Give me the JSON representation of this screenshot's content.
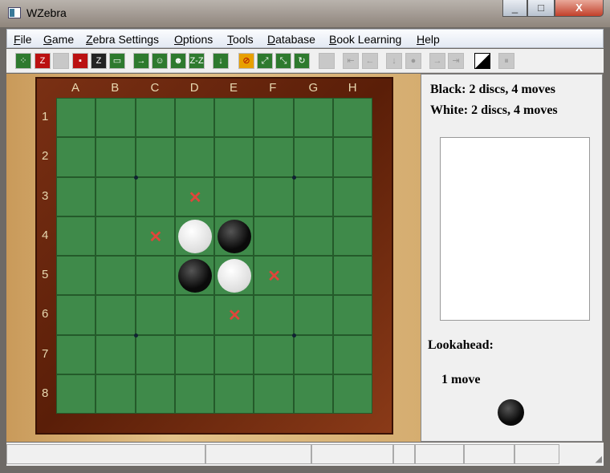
{
  "window": {
    "title": "WZebra",
    "min": "_",
    "max": "□",
    "close": "X"
  },
  "menu": [
    "File",
    "Game",
    "Zebra Settings",
    "Options",
    "Tools",
    "Database",
    "Book Learning",
    "Help"
  ],
  "toolbar": [
    {
      "icon": "new-game-icon",
      "c": "g",
      "t": "⁘"
    },
    {
      "icon": "zebra-book-icon",
      "c": "r",
      "t": "Z"
    },
    {
      "icon": "disabled-icon",
      "c": "d",
      "t": ""
    },
    {
      "icon": "save-book-icon",
      "c": "r",
      "t": "▪"
    },
    {
      "icon": "save-disk-icon",
      "c": "k",
      "t": "Z"
    },
    {
      "icon": "open-folder-icon",
      "c": "g",
      "t": "▭"
    },
    {
      "icon": "play-arrow-icon",
      "c": "g",
      "t": "→"
    },
    {
      "icon": "human-player-icon",
      "c": "g",
      "t": "☺"
    },
    {
      "icon": "computer-player-icon",
      "c": "g",
      "t": "☻"
    },
    {
      "icon": "auto-play-icon",
      "c": "g",
      "t": "Z-Z"
    },
    {
      "icon": "move-down-icon",
      "c": "g",
      "t": "↓"
    },
    {
      "icon": "stop-icon",
      "c": "o",
      "t": "⊘"
    },
    {
      "icon": "expand-icon",
      "c": "g",
      "t": "⤢"
    },
    {
      "icon": "expand-alt-icon",
      "c": "g",
      "t": "⤡"
    },
    {
      "icon": "rotate-icon",
      "c": "g",
      "t": "↻"
    },
    {
      "icon": "page-icon",
      "c": "d",
      "t": ""
    },
    {
      "icon": "first-move-icon",
      "c": "d",
      "t": "⇤"
    },
    {
      "icon": "back-icon",
      "c": "d",
      "t": "←"
    },
    {
      "icon": "down-arrow-icon",
      "c": "d",
      "t": "↓"
    },
    {
      "icon": "hint-bulb-icon",
      "c": "d",
      "t": "●"
    },
    {
      "icon": "forward-icon",
      "c": "d",
      "t": "→"
    },
    {
      "icon": "last-move-icon",
      "c": "d",
      "t": "⇥"
    },
    {
      "icon": "black-white-toggle-icon",
      "c": "bw",
      "t": ""
    },
    {
      "icon": "pause-icon",
      "c": "d",
      "t": "⏸"
    }
  ],
  "board": {
    "columns": [
      "A",
      "B",
      "C",
      "D",
      "E",
      "F",
      "G",
      "H"
    ],
    "rows": [
      "1",
      "2",
      "3",
      "4",
      "5",
      "6",
      "7",
      "8"
    ],
    "discs": [
      {
        "sq": "D4",
        "color": "white"
      },
      {
        "sq": "E4",
        "color": "black"
      },
      {
        "sq": "D5",
        "color": "black"
      },
      {
        "sq": "E5",
        "color": "white"
      }
    ],
    "legal_moves": [
      "D3",
      "C4",
      "F5",
      "E6"
    ],
    "mark": "✕"
  },
  "panel": {
    "black_status": "Black:  2 discs, 4 moves",
    "white_status": "White:  2 discs, 4 moves",
    "lookahead_label": "Lookahead:",
    "lookahead_value": "1 move",
    "to_move": "black"
  },
  "status": [
    "",
    "",
    "",
    "",
    "",
    "",
    ""
  ]
}
